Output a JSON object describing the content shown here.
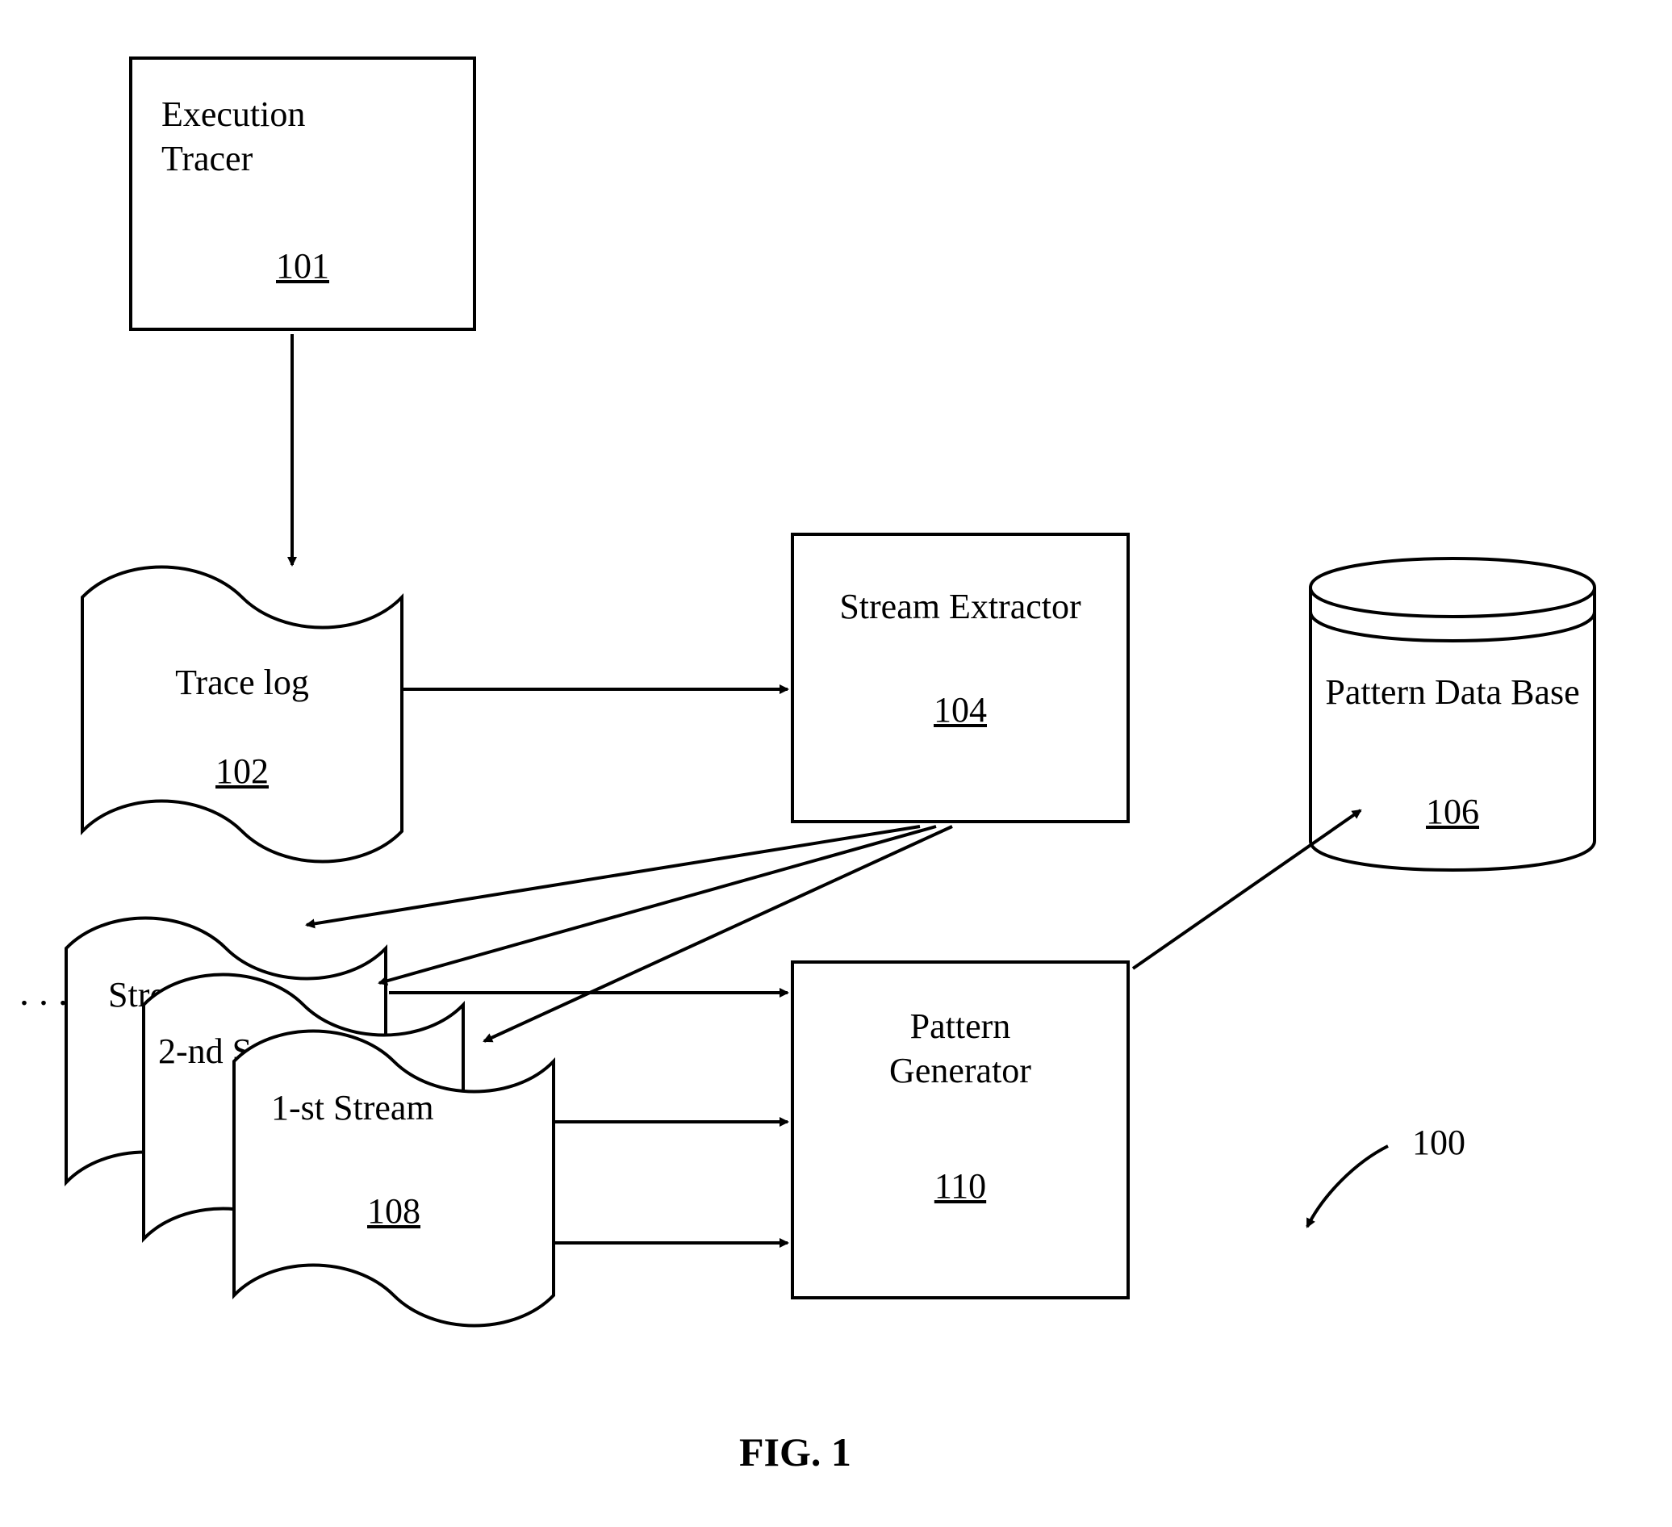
{
  "boxes": {
    "execution_tracer": {
      "title": "Execution\nTracer",
      "ref": "101"
    },
    "stream_extractor": {
      "title": "Stream Extractor",
      "ref": "104"
    },
    "pattern_generator": {
      "title": "Pattern\nGenerator",
      "ref": "110"
    }
  },
  "docs": {
    "trace_log": {
      "title": "Trace log",
      "ref": "102"
    },
    "stream_back": {
      "title": "Stream"
    },
    "stream_mid": {
      "title": "2-nd Stream"
    },
    "stream_front": {
      "title": "1-st Stream",
      "ref": "108"
    }
  },
  "cylinder": {
    "pattern_db": {
      "title": "Pattern\nData Base",
      "ref": "106"
    }
  },
  "figure": {
    "overall_ref": "100",
    "caption": "FIG. 1",
    "ellipsis": ". . ."
  }
}
